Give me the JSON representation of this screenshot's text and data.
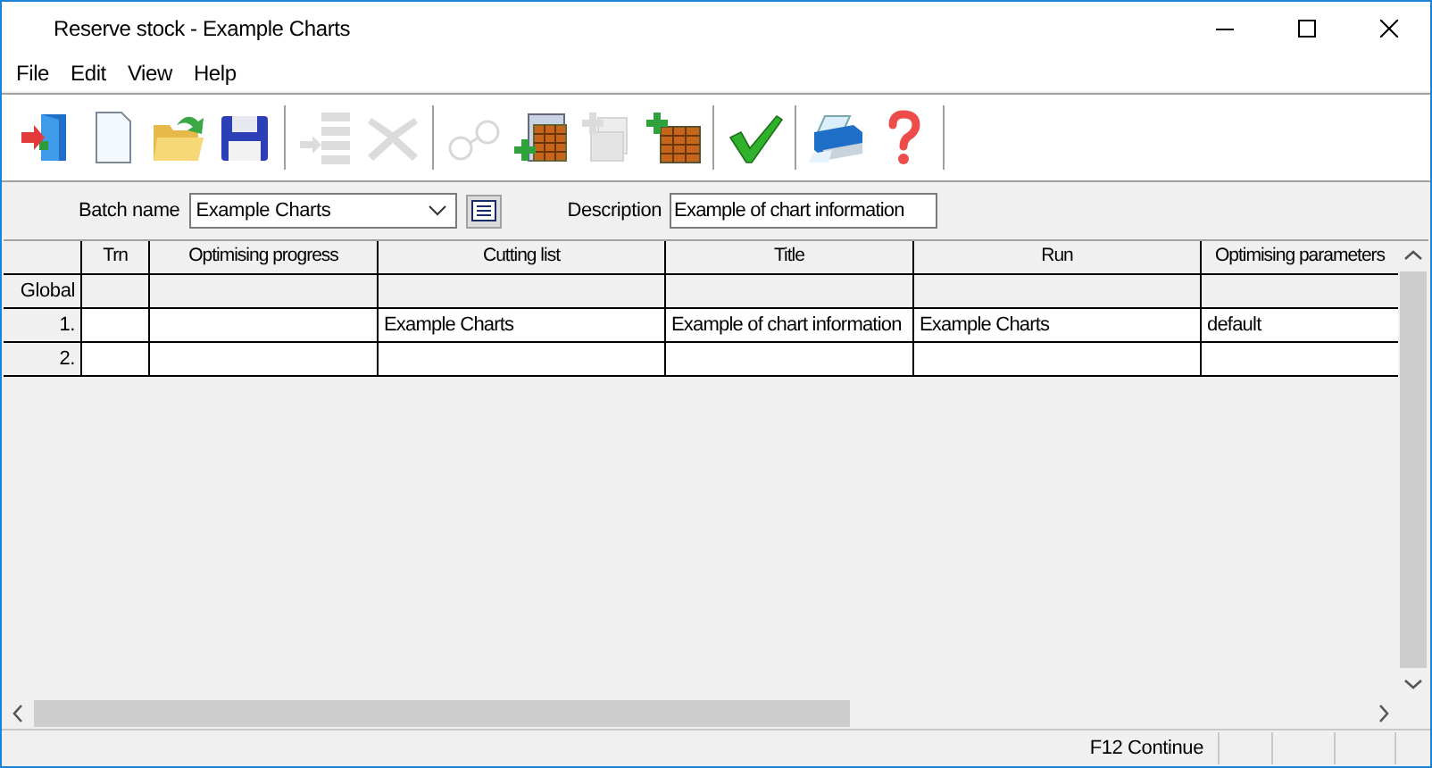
{
  "window": {
    "title": "Reserve stock - Example Charts"
  },
  "menu": [
    "File",
    "Edit",
    "View",
    "Help"
  ],
  "toolbar": [
    {
      "kind": "exit",
      "disabled": false
    },
    {
      "kind": "new",
      "disabled": false
    },
    {
      "kind": "open",
      "disabled": false
    },
    {
      "kind": "save",
      "disabled": false
    },
    {
      "kind": "separator"
    },
    {
      "kind": "insert",
      "disabled": true
    },
    {
      "kind": "delete",
      "disabled": true
    },
    {
      "kind": "separator"
    },
    {
      "kind": "view",
      "disabled": true
    },
    {
      "kind": "add-bricks",
      "disabled": false
    },
    {
      "kind": "add-docs",
      "disabled": true
    },
    {
      "kind": "add-grid",
      "disabled": false
    },
    {
      "kind": "separator"
    },
    {
      "kind": "check",
      "disabled": false
    },
    {
      "kind": "separator"
    },
    {
      "kind": "print",
      "disabled": false
    },
    {
      "kind": "help",
      "disabled": false
    },
    {
      "kind": "separator"
    }
  ],
  "form": {
    "batch_label": "Batch name",
    "batch_value": "Example Charts",
    "description_label": "Description",
    "description_value": "Example of chart information"
  },
  "table": {
    "columns": [
      "Trn",
      "Optimising progress",
      "Cutting list",
      "Title",
      "Run",
      "Optimising parameters"
    ],
    "rows": [
      {
        "header": "Global",
        "kind": "global",
        "cells": [
          "",
          "",
          "",
          "",
          "",
          ""
        ]
      },
      {
        "header": "1.",
        "kind": "data",
        "cells": [
          "",
          "",
          "Example Charts",
          "Example of chart information",
          "Example Charts",
          "default"
        ]
      },
      {
        "header": "2.",
        "kind": "data",
        "cells": [
          "",
          "",
          "",
          "",
          "",
          ""
        ]
      }
    ]
  },
  "status_bar": {
    "text": "F12 Continue"
  }
}
